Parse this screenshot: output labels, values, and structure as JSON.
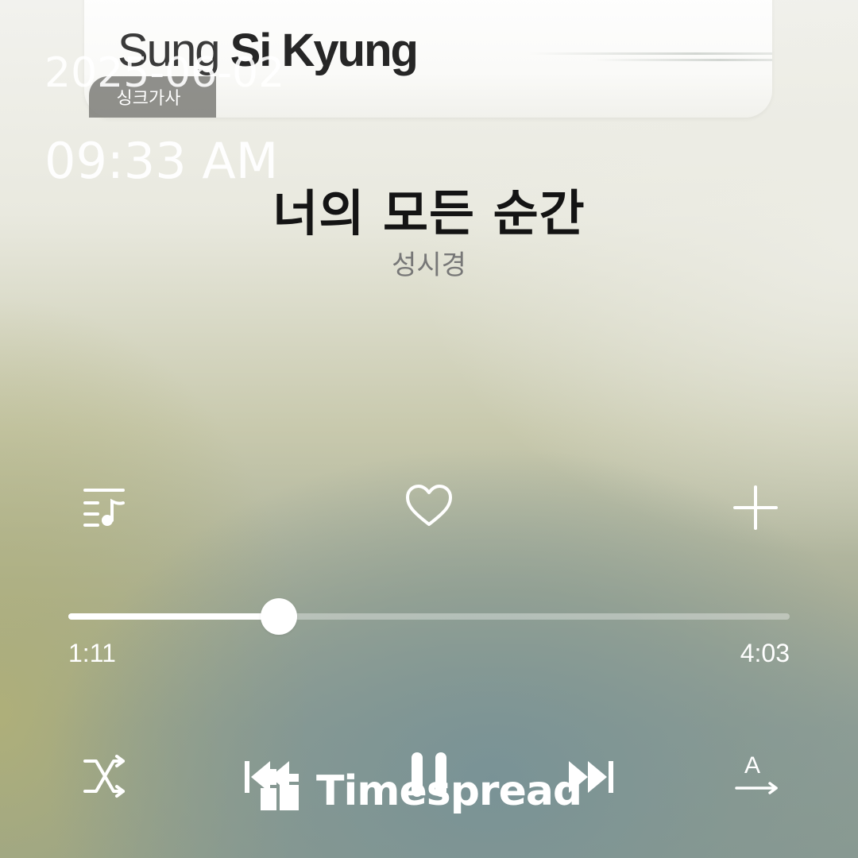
{
  "album_art": {
    "artist_first": "Sung",
    "artist_last": "Si Kyung"
  },
  "overlay": {
    "date": "2025-06-02",
    "time": "09:33 AM"
  },
  "badge": {
    "sync_lyrics": "싱크가사"
  },
  "song": {
    "title": "너의 모든 순간",
    "artist": "성시경"
  },
  "actions": {
    "playlist_icon": "playlist-music-icon",
    "like_icon": "heart-outline-icon",
    "add_icon": "plus-icon"
  },
  "playback": {
    "elapsed": "1:11",
    "total": "4:03",
    "progress": 0.2922
  },
  "controls": {
    "shuffle_icon": "shuffle-icon",
    "previous_icon": "rewind-icon",
    "play_pause_icon": "pause-icon",
    "next_icon": "fast-forward-icon",
    "translate_icon": "lyrics-translate-icon",
    "translate_glyph": "A"
  },
  "watermark": {
    "text": "Timespread"
  },
  "colors": {
    "title": "#141414",
    "artist": "#777777",
    "controls": "#ffffff",
    "badge_bg": "#7d7d78"
  }
}
